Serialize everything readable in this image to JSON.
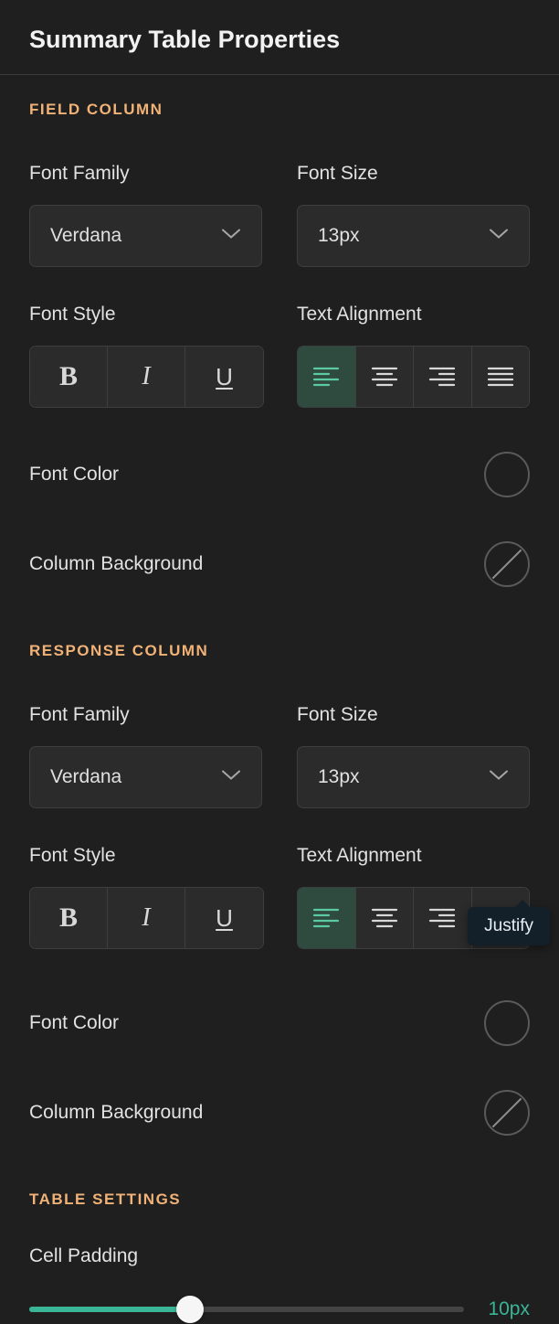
{
  "header": {
    "title": "Summary Table Properties"
  },
  "sections": {
    "field": {
      "title": "FIELD COLUMN",
      "fontFamily": {
        "label": "Font Family",
        "value": "Verdana"
      },
      "fontSize": {
        "label": "Font Size",
        "value": "13px"
      },
      "fontStyle": {
        "label": "Font Style",
        "bold": false,
        "italic": false,
        "underline": false
      },
      "textAlignment": {
        "label": "Text Alignment",
        "value": "left"
      },
      "fontColor": {
        "label": "Font Color",
        "value": "#1f1f1f"
      },
      "columnBackground": {
        "label": "Column Background",
        "value": null
      }
    },
    "response": {
      "title": "RESPONSE COLUMN",
      "fontFamily": {
        "label": "Font Family",
        "value": "Verdana"
      },
      "fontSize": {
        "label": "Font Size",
        "value": "13px"
      },
      "fontStyle": {
        "label": "Font Style",
        "bold": false,
        "italic": false,
        "underline": false
      },
      "textAlignment": {
        "label": "Text Alignment",
        "value": "left"
      },
      "fontColor": {
        "label": "Font Color",
        "value": "#1f1f1f"
      },
      "columnBackground": {
        "label": "Column Background",
        "value": null
      }
    },
    "table": {
      "title": "TABLE SETTINGS",
      "cellPadding": {
        "label": "Cell Padding",
        "value": 10,
        "display": "10px",
        "min": 0,
        "max": 27,
        "percent": 37
      }
    }
  },
  "tooltip": {
    "text": "Justify"
  },
  "colors": {
    "accent": "#3ab595",
    "sectionTitle": "#f0b277"
  },
  "icons": {
    "bold": "bold-icon",
    "italic": "italic-icon",
    "underline": "underline-icon",
    "alignLeft": "align-left-icon",
    "alignCenter": "align-center-icon",
    "alignRight": "align-right-icon",
    "alignJustify": "align-justify-icon",
    "chevronDown": "chevron-down-icon"
  }
}
